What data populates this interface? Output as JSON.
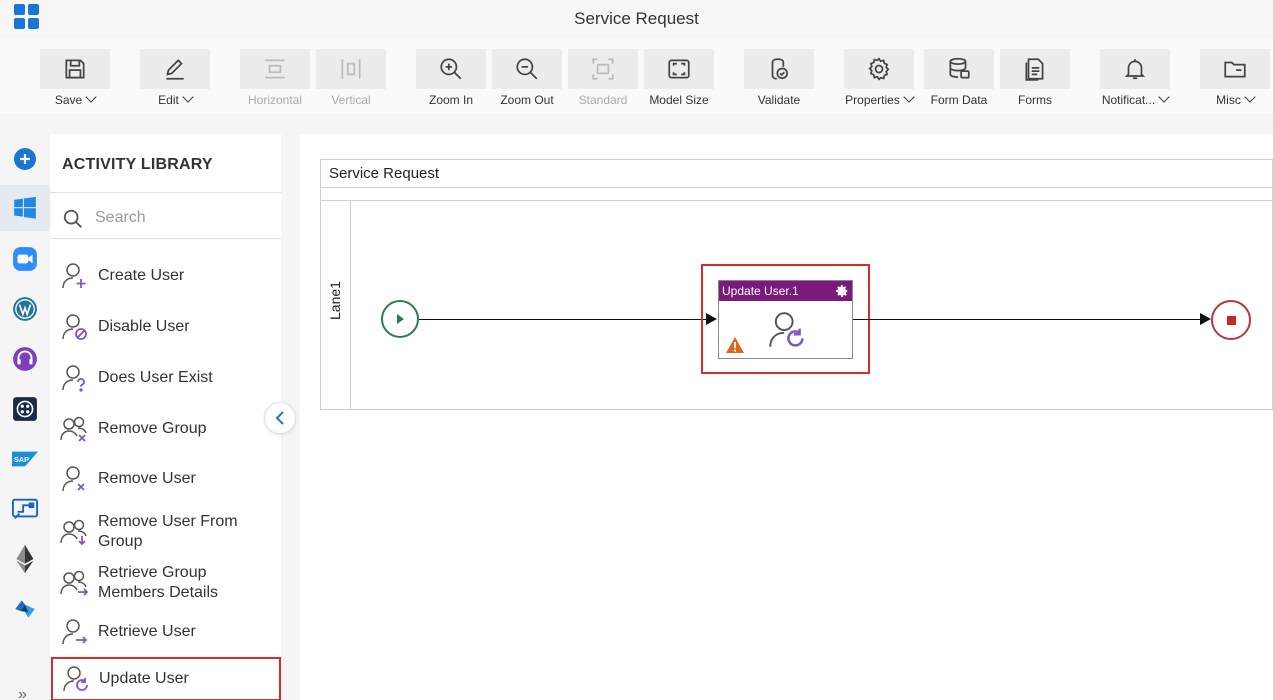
{
  "app": {
    "title": "Service Request"
  },
  "toolbar": {
    "save": "Save",
    "edit": "Edit",
    "horizontal": "Horizontal",
    "vertical": "Vertical",
    "zoom_in": "Zoom In",
    "zoom_out": "Zoom Out",
    "standard": "Standard",
    "model_size": "Model Size",
    "validate": "Validate",
    "properties": "Properties",
    "form_data": "Form Data",
    "forms": "Forms",
    "notifications": "Notificat...",
    "misc": "Misc"
  },
  "library": {
    "title": "ACTIVITY LIBRARY",
    "search_placeholder": "Search",
    "items": [
      {
        "label": "Create User"
      },
      {
        "label": "Disable User"
      },
      {
        "label": "Does User Exist"
      },
      {
        "label": "Remove Group"
      },
      {
        "label": "Remove User"
      },
      {
        "label": "Remove User From Group"
      },
      {
        "label": "Retrieve Group Members Details"
      },
      {
        "label": "Retrieve User"
      },
      {
        "label": "Update User"
      }
    ]
  },
  "canvas": {
    "pool_title": "Service Request",
    "lane_label": "Lane1",
    "task_title": "Update User.1"
  },
  "colors": {
    "accent": "#1976d2",
    "task_header": "#7b1a7a",
    "highlight": "#d32f2f",
    "start": "#2e7d4f",
    "end": "#c62828",
    "icon_purple": "#7e57c2"
  }
}
